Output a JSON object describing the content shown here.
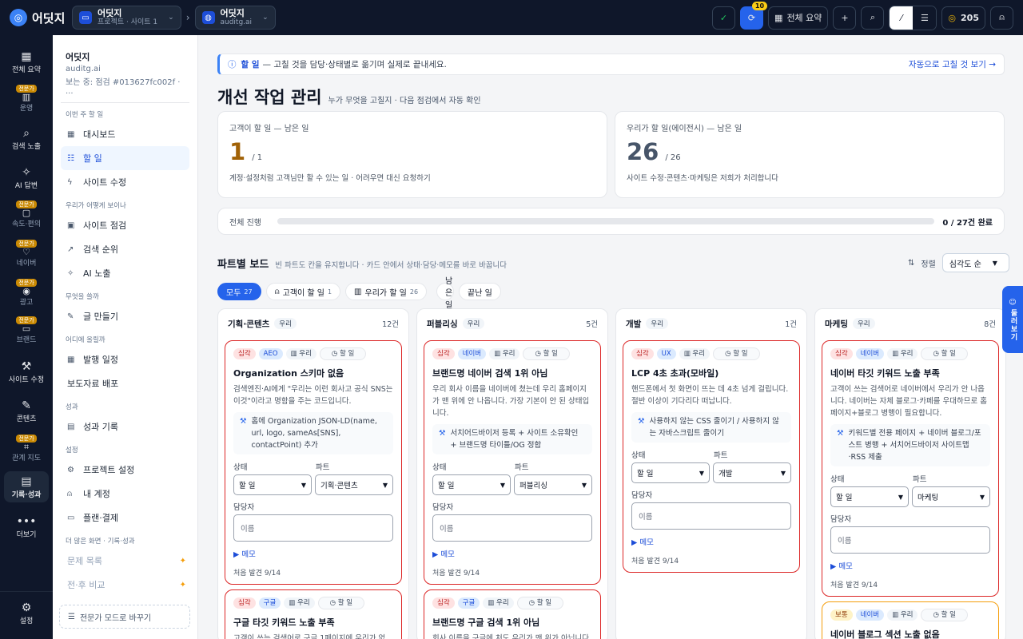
{
  "topbar": {
    "app_name": "어딧지",
    "project": {
      "name": "어딧지",
      "sub": "프로젝트 · 사이트 1"
    },
    "site": {
      "name": "어딧지",
      "sub": "auditg.ai"
    },
    "sync_badge": "10",
    "summary_label": "전체 요약",
    "credits": "205"
  },
  "rail": {
    "items": [
      {
        "label": "전체 요약",
        "icon": "grid-icon"
      },
      {
        "label": "운영",
        "tag": "전문가",
        "icon": "panel-icon"
      },
      {
        "label": "검색 노출",
        "icon": "search-icon"
      },
      {
        "label": "AI 답변",
        "icon": "sparkle-icon"
      },
      {
        "label": "속도·편의",
        "tag": "전문가",
        "icon": "speed-icon"
      },
      {
        "label": "네이버",
        "tag": "전문가",
        "icon": "naver-icon"
      },
      {
        "label": "광고",
        "tag": "전문가",
        "icon": "ad-icon"
      },
      {
        "label": "브랜드",
        "tag": "전문가",
        "icon": "brand-icon"
      },
      {
        "label": "사이트 수정",
        "icon": "wrench-icon"
      },
      {
        "label": "콘텐츠",
        "icon": "pen-icon"
      },
      {
        "label": "관계 지도",
        "tag": "전문가",
        "icon": "map-icon"
      },
      {
        "label": "기록·성과",
        "icon": "doc-icon"
      },
      {
        "label": "더보기",
        "icon": "more-icon"
      },
      {
        "label": "설정",
        "icon": "gear-icon"
      }
    ]
  },
  "sidebar": {
    "site_name": "어딧지",
    "domain": "auditg.ai",
    "viewing": "보는 중: 점검 #013627fc002f · ...",
    "sections": [
      {
        "title": "이번 주 할 일"
      },
      {
        "title": "우리가 어떻게 보이나"
      },
      {
        "title": "무엇을 쓸까"
      },
      {
        "title": "어디에 올릴까"
      },
      {
        "title": "성과"
      },
      {
        "title": "설정"
      },
      {
        "title": "더 많은 화면 · 기록·성과"
      }
    ],
    "items": {
      "dashboard": "대시보드",
      "todo": "할 일",
      "site_fix": "사이트 수정",
      "site_audit": "사이트 점검",
      "rank": "검색 순위",
      "ai_exposure": "AI 노출",
      "write": "글 만들기",
      "schedule": "발행 일정",
      "press": "보도자료 배포",
      "records": "성과 기록",
      "project_settings": "프로젝트 설정",
      "account": "내 계정",
      "billing": "플랜·결제",
      "issues": "문제 목록",
      "compare": "전·후 비교"
    },
    "switch_label": "전문가 모드로 바꾸기"
  },
  "notice": {
    "bold": "할 일",
    "text": "— 고칠 것을 담당·상태별로 옮기며 실제로 끝내세요.",
    "cta": "자동으로 고칠 것 보기 →"
  },
  "header": {
    "title": "개선 작업 관리",
    "subtitle": "누가 무엇을 고칠지 · 다음 점검에서 자동 확인"
  },
  "stats": [
    {
      "label": "고객이 할 일 — 남은 일",
      "value": "1",
      "total": "/ 1",
      "desc": "계정·설정처럼 고객님만 할 수 있는 일 · 어려우면 대신 요청하기",
      "color": "#a16207"
    },
    {
      "label": "우리가 할 일(에이전시) — 남은 일",
      "value": "26",
      "total": "/ 26",
      "desc": "사이트 수정·콘텐츠·마케팅은 저희가 처리합니다",
      "color": "#475569"
    }
  ],
  "progress": {
    "label": "전체 진행",
    "summary": "0 / 27건 완료",
    "fraction": 0.0
  },
  "board": {
    "title": "파트별 보드",
    "subtitle": "빈 파트도 칸을 유지합니다 · 카드 안에서 상태·담당·메모를 바로 바꿉니다",
    "sort_label": "정렬",
    "sort_value": "심각도 순",
    "filters": [
      {
        "label": "모두",
        "count": "27"
      },
      {
        "label": "고객이 할 일",
        "count": "1"
      },
      {
        "label": "우리가 할 일",
        "count": "26"
      },
      {
        "label": "남은 일",
        "count": ""
      },
      {
        "label": "끝난 일",
        "count": ""
      }
    ]
  },
  "common": {
    "status_label": "상태",
    "part_label": "파트",
    "assignee_label": "담당자",
    "assignee_placeholder": "이름",
    "memo": "▶ 메모",
    "todo_tag": "할 일",
    "status_value": "할 일",
    "owner": "우리"
  },
  "columns": [
    {
      "name": "기획·콘텐츠",
      "owner": "우리",
      "count": "12건",
      "cards": [
        {
          "severity": "심각",
          "channel": "AEO",
          "owner": "우리",
          "title": "Organization 스키마 없음",
          "desc": "검색엔진·AI에게 \"우리는 이런 회사고 공식 SNS는 이것\"이라고 명함을 주는 코드입니다.",
          "fix": "홈에 Organization JSON-LD(name, url, logo, sameAs[SNS], contactPoint) 추가",
          "part": "기획·콘텐츠",
          "found": "처음 발견 9/14"
        },
        {
          "severity": "심각",
          "channel": "구글",
          "owner": "우리",
          "title": "구글 타깃 키워드 노출 부족",
          "desc": "고객이 쓰는 검색어로 구글 1페이지에 우리가 없"
        }
      ]
    },
    {
      "name": "퍼블리싱",
      "owner": "우리",
      "count": "5건",
      "cards": [
        {
          "severity": "심각",
          "channel": "네이버",
          "owner": "우리",
          "title": "브랜드명 네이버 검색 1위 아님",
          "desc": "우리 회사 이름을 네이버에 쳤는데 우리 홈페이지가 맨 위에 안 나옵니다. 가장 기본이 안 된 상태입니다.",
          "fix": "서치어드바이저 등록 + 사이트 소유확인 + 브랜드명 타이틀/OG 정합",
          "part": "퍼블리싱",
          "found": "처음 발견 9/14"
        },
        {
          "severity": "심각",
          "channel": "구글",
          "owner": "우리",
          "title": "브랜드명 구글 검색 1위 아님",
          "desc": "회사 이름을 구글에 처도 우리가 맨 위가 아닙니다."
        }
      ]
    },
    {
      "name": "개발",
      "owner": "우리",
      "count": "1건",
      "cards": [
        {
          "severity": "심각",
          "channel": "UX",
          "owner": "우리",
          "title": "LCP 4초 초과(모바일)",
          "desc": "핸드폰에서 첫 화면이 뜨는 데 4초 넘게 걸립니다. 절반 이상이 기다리다 떠납니다.",
          "fix": "사용하지 않는 CSS 줄이기 / 사용하지 않는 자바스크립트 줄이기",
          "part": "개발",
          "found": "처음 발견 9/14"
        }
      ]
    },
    {
      "name": "마케팅",
      "owner": "우리",
      "count": "8건",
      "cards": [
        {
          "severity": "심각",
          "channel": "네이버",
          "owner": "우리",
          "title": "네이버 타깃 키워드 노출 부족",
          "desc": "고객이 쓰는 검색어로 네이버에서 우리가 안 나옵니다. 네이버는 자체 블로그·카페를 우대하므로 홈페이지+블로그 병행이 필요합니다.",
          "fix": "키워드별 전용 페이지 + 네이버 블로그/포스트 병행 + 서치어드바이저 사이트맵·RSS 제출",
          "part": "마케팅",
          "found": "처음 발견 9/14"
        },
        {
          "severity": "보통",
          "channel": "네이버",
          "owner": "우리",
          "title": "네이버 블로그 섹션 노출 없음"
        }
      ]
    }
  ],
  "float_button": "둘러보기",
  "colors": {
    "accent": "#2563eb",
    "critical": "#dc2626",
    "warning": "#f59e0b",
    "nav_bg": "#0f172a"
  }
}
